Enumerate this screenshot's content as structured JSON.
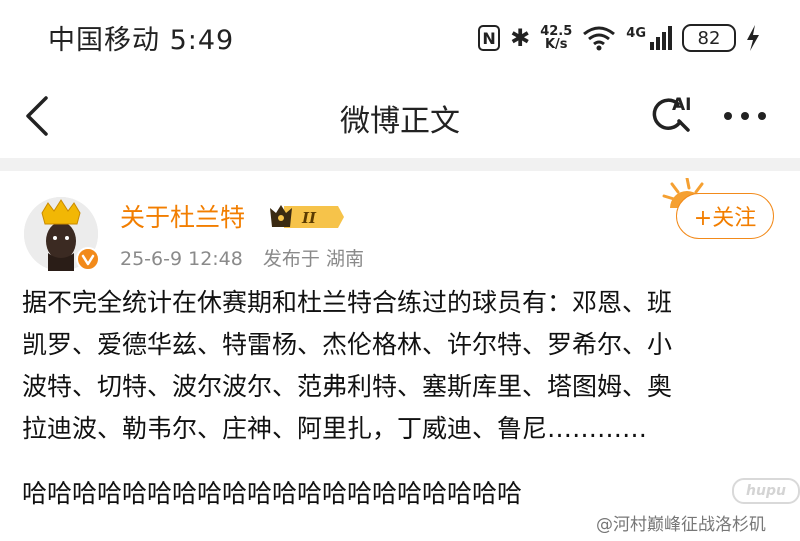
{
  "status_bar": {
    "carrier_time": "中国移动 5:49",
    "nfc": "N",
    "bluetooth": "✱",
    "net_speed_value": "42.5",
    "net_speed_unit": "K/s",
    "network": "4G",
    "battery": "82"
  },
  "header": {
    "title": "微博正文",
    "ai_label": "AI"
  },
  "post": {
    "user_name": "关于杜兰特",
    "level": "II",
    "date": "25-6-9 12:48",
    "location": "发布于 湖南",
    "follow_label": "+关注",
    "text_lines": [
      "据不完全统计在休赛期和杜兰特合练过的球员有：邓恩、班",
      "凯罗、爱德华兹、特雷杨、杰伦格林、许尔特、罗希尔、小",
      "波特、切特、波尔波尔、范弗利特、塞斯库里、塔图姆、奥",
      "拉迪波、勒韦尔、庄神、阿里扎，丁威迪、鲁尼…………"
    ],
    "laugh": "哈哈哈哈哈哈哈哈哈哈哈哈哈哈哈哈哈哈哈哈"
  },
  "watermark": {
    "hupu": "hupu",
    "credit": "@河村巅峰征战洛杉矶"
  },
  "colors": {
    "accent": "#f27e00",
    "meta": "#8a8a8a",
    "divider": "#f1f1f1"
  }
}
